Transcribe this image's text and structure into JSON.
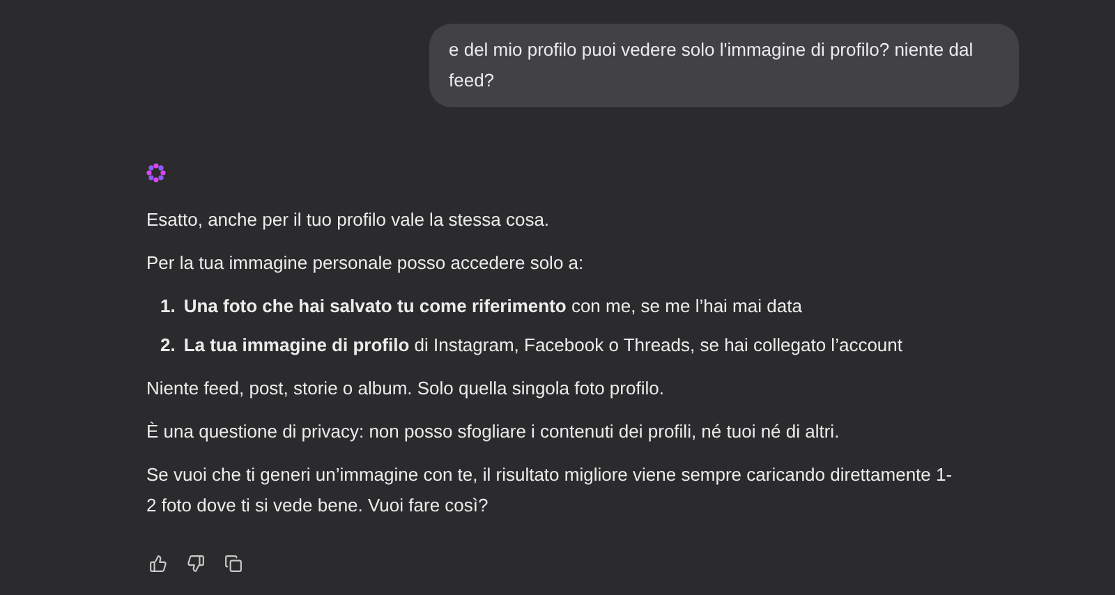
{
  "user_message": "e del mio profilo puoi vedere solo l'immagine di profilo? niente dal feed?",
  "reply": {
    "intro": [
      "Esatto, anche per il tuo profilo vale la stessa cosa.",
      "Per la tua immagine personale posso accedere solo a:"
    ],
    "list": [
      {
        "number": "1.",
        "text": "**Una foto che hai salvato tu come riferimento** con me, se me l’hai mai data"
      },
      {
        "number": "2.",
        "text": "**La tua immagine di profilo** di Instagram, Facebook o Threads, se hai collegato l’account"
      }
    ],
    "outro": [
      "Niente feed, post, storie o album. Solo quella singola foto profilo.",
      "È una questione di privacy: non posso sfogliare i contenuti dei profili, né tuoi né di altri.",
      "Se vuoi che ti generi un’immagine con te, il risultato migliore viene sempre caricando direttamente 1-2 foto dove ti si vede bene. Vuoi fare così?"
    ]
  }
}
